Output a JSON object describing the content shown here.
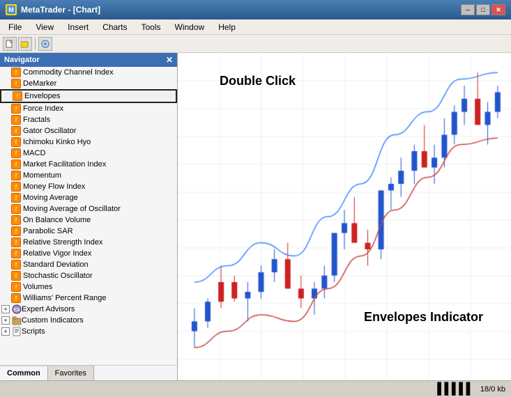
{
  "window": {
    "title": "MetaTrader - [Chart]",
    "title_icon": "MT",
    "min_btn": "─",
    "max_btn": "□",
    "close_btn": "✕"
  },
  "menu": {
    "items": [
      "File",
      "View",
      "Insert",
      "Charts",
      "Tools",
      "Window",
      "Help"
    ]
  },
  "navigator": {
    "title": "Navigator",
    "close_btn": "✕",
    "tabs": [
      {
        "label": "Common",
        "active": true
      },
      {
        "label": "Favorites",
        "active": false
      }
    ]
  },
  "tree": {
    "indicators": [
      {
        "label": "Commodity Channel Index",
        "type": "indicator"
      },
      {
        "label": "DeMarker",
        "type": "indicator"
      },
      {
        "label": "Envelopes",
        "type": "indicator",
        "highlighted": true
      },
      {
        "label": "Force Index",
        "type": "indicator"
      },
      {
        "label": "Fractals",
        "type": "indicator"
      },
      {
        "label": "Gator Oscillator",
        "type": "indicator"
      },
      {
        "label": "Ichimoku Kinko Hyo",
        "type": "indicator"
      },
      {
        "label": "MACD",
        "type": "indicator"
      },
      {
        "label": "Market Facilitation Index",
        "type": "indicator"
      },
      {
        "label": "Momentum",
        "type": "indicator"
      },
      {
        "label": "Money Flow Index",
        "type": "indicator"
      },
      {
        "label": "Moving Average",
        "type": "indicator"
      },
      {
        "label": "Moving Average of Oscillator",
        "type": "indicator"
      },
      {
        "label": "On Balance Volume",
        "type": "indicator"
      },
      {
        "label": "Parabolic SAR",
        "type": "indicator"
      },
      {
        "label": "Relative Strength Index",
        "type": "indicator"
      },
      {
        "label": "Relative Vigor Index",
        "type": "indicator"
      },
      {
        "label": "Standard Deviation",
        "type": "indicator"
      },
      {
        "label": "Stochastic Oscillator",
        "type": "indicator"
      },
      {
        "label": "Volumes",
        "type": "indicator"
      },
      {
        "label": "Williams' Percent Range",
        "type": "indicator"
      }
    ],
    "groups": [
      {
        "label": "Expert Advisors",
        "type": "group"
      },
      {
        "label": "Custom Indicators",
        "type": "group"
      },
      {
        "label": "Scripts",
        "type": "group"
      }
    ]
  },
  "chart": {
    "double_click_label": "Double Click",
    "envelopes_label": "Envelopes Indicator"
  },
  "status_bar": {
    "segments": [
      "",
      "",
      "",
      ""
    ],
    "right_text": "18/0 kb"
  }
}
